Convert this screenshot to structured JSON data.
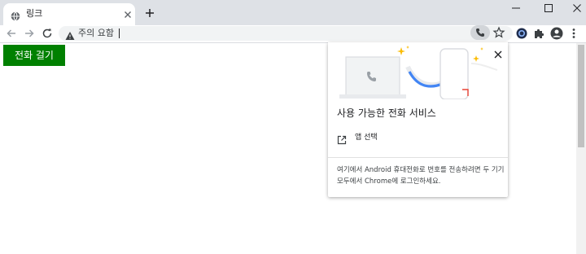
{
  "tab": {
    "title": "링크",
    "favicon": "globe-icon"
  },
  "window_controls": [
    "minimize-icon",
    "maximize-icon",
    "close-icon"
  ],
  "toolbar": {
    "security_label": "주의 요함",
    "url_value": "",
    "icons": [
      "back-arrow-icon",
      "forward-arrow-icon",
      "reload-icon",
      "phone-icon",
      "star-icon",
      "extension-app-icon",
      "puzzle-icon",
      "profile-icon",
      "menu-icon"
    ]
  },
  "page": {
    "call_button_label": "전화 걸기"
  },
  "popup": {
    "heading": "사용 가능한 전화 서비스",
    "pick_app_label": "앱 선택",
    "note": "여기에서 Android 휴대전화로 번호를 전송하려면 두 기기 모두에서 Chrome에 로그인하세요."
  },
  "colors": {
    "call_button_bg": "#008000",
    "tabstrip_bg": "#dee1e6",
    "illustration_blue": "#4285f4",
    "illustration_red": "#ea4335",
    "sparkle_yellow": "#fbbc04"
  }
}
